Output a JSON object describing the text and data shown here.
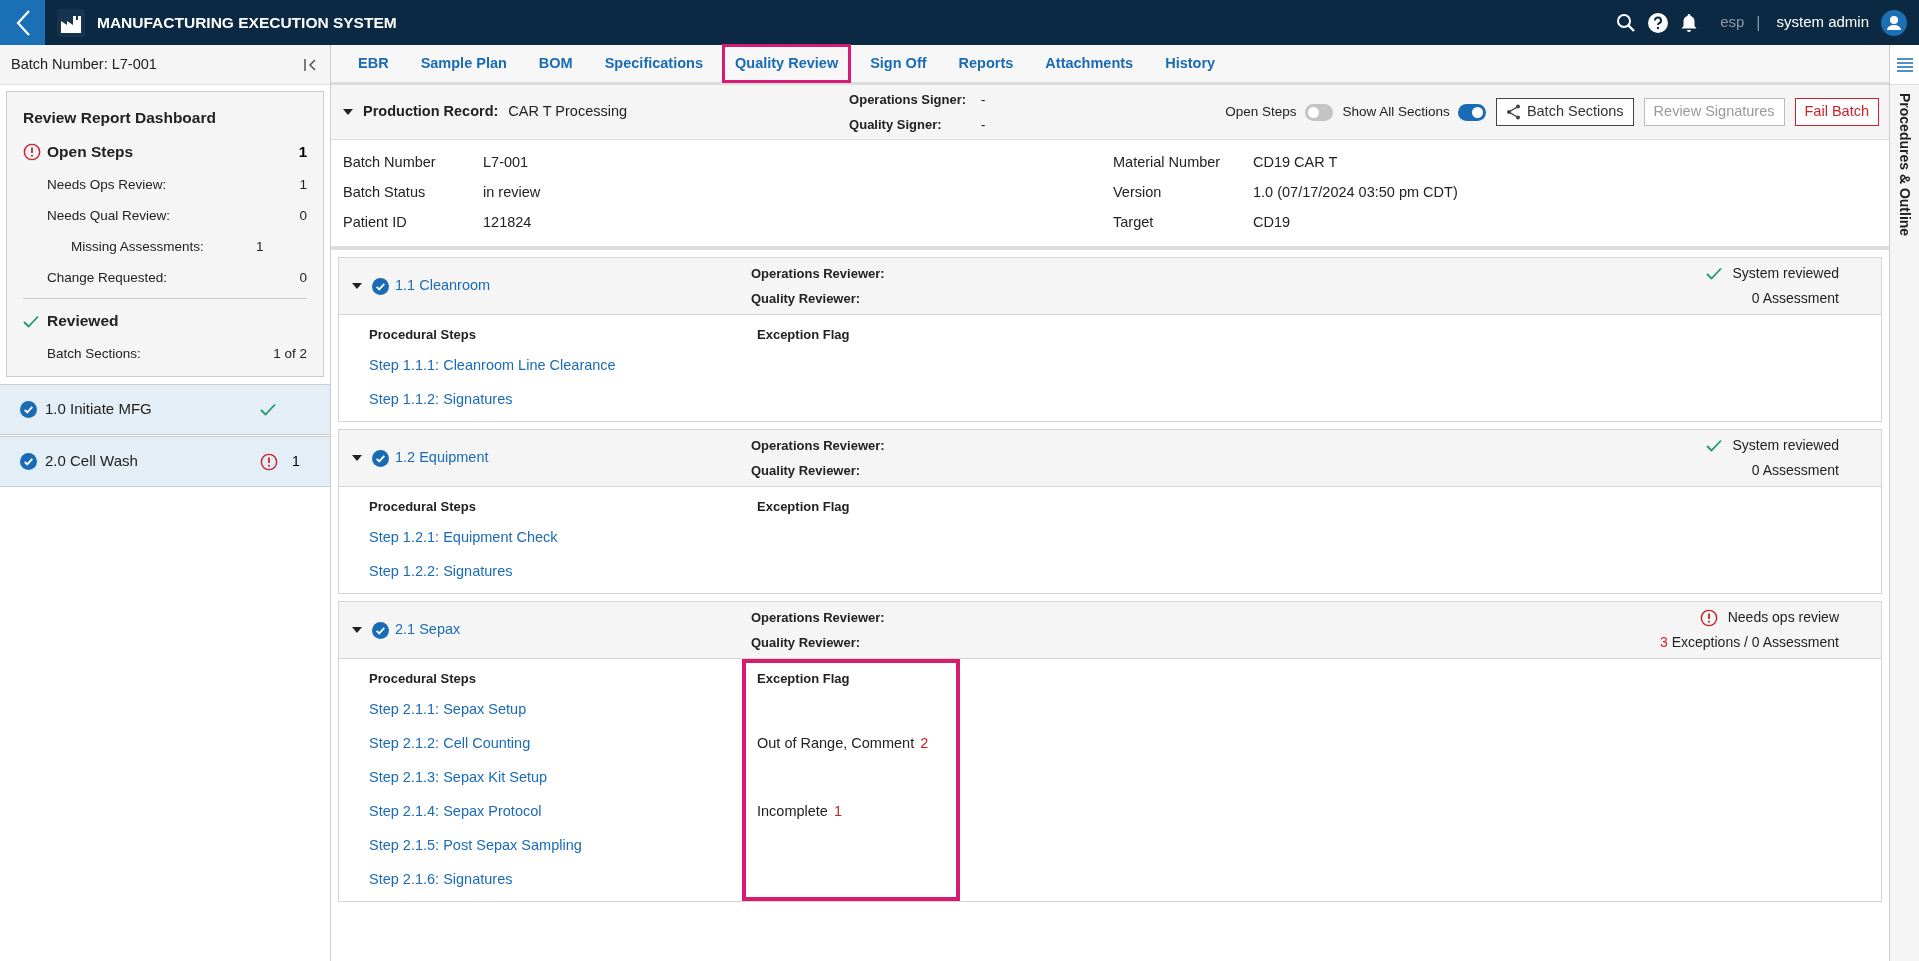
{
  "app": {
    "title": "MANUFACTURING EXECUTION SYSTEM",
    "user_group": "esp",
    "user": "system admin",
    "separator": "|"
  },
  "sidebar": {
    "title": "Batch Number: L7-001",
    "dashboard": {
      "title": "Review Report Dashboard",
      "groups": [
        {
          "kind": "alert",
          "label": "Open Steps",
          "count": "1",
          "rows": [
            {
              "label": "Needs Ops Review:",
              "value": "1"
            },
            {
              "label": "Needs Qual Review:",
              "value": "0",
              "children": [
                {
                  "label": "Missing Assessments:",
                  "value": "1"
                }
              ]
            },
            {
              "label": "Change Requested:",
              "value": "0"
            }
          ]
        },
        {
          "kind": "check",
          "label": "Reviewed",
          "rows": [
            {
              "label": "Batch Sections:",
              "value": "1 of 2"
            }
          ]
        }
      ]
    },
    "items": [
      {
        "label": "1.0 Initiate MFG",
        "kind": "check"
      },
      {
        "label": "2.0 Cell Wash",
        "kind": "alert",
        "count": "1"
      }
    ]
  },
  "tabs": [
    {
      "label": "EBR",
      "selected": false
    },
    {
      "label": "Sample Plan",
      "selected": false
    },
    {
      "label": "BOM",
      "selected": false
    },
    {
      "label": "Specifications",
      "selected": false
    },
    {
      "label": "Quality Review",
      "selected": true
    },
    {
      "label": "Sign Off",
      "selected": false
    },
    {
      "label": "Reports",
      "selected": false
    },
    {
      "label": "Attachments",
      "selected": false
    },
    {
      "label": "History",
      "selected": false
    }
  ],
  "production_record": {
    "label": "Production Record:",
    "value": "CAR T Processing",
    "signers": [
      {
        "label": "Operations Signer:",
        "value": "-"
      },
      {
        "label": "Quality Signer:",
        "value": "-"
      }
    ],
    "toggles": [
      {
        "label": "Open Steps",
        "on": false
      },
      {
        "label": "Show All Sections",
        "on": true
      }
    ],
    "buttons": [
      {
        "label": "Batch Sections",
        "kind": "share"
      },
      {
        "label": "Review Signatures",
        "kind": "disabled"
      },
      {
        "label": "Fail Batch",
        "kind": "danger"
      }
    ]
  },
  "details": {
    "left": [
      {
        "label": "Batch Number",
        "value": "L7-001"
      },
      {
        "label": "Batch Status",
        "value": "in review"
      },
      {
        "label": "Patient ID",
        "value": "121824"
      }
    ],
    "right": [
      {
        "label": "Material Number",
        "value": "CD19 CAR T"
      },
      {
        "label": "Version",
        "value": "1.0 (07/17/2024 03:50 pm CDT)"
      },
      {
        "label": "Target",
        "value": "CD19"
      }
    ]
  },
  "sections": [
    {
      "title": "1.1 Cleanroom",
      "reviewers": [
        "Operations Reviewer:",
        "Quality Reviewer:"
      ],
      "kind": "check",
      "status": "System reviewed",
      "assessment": "0 Assessment",
      "columns": [
        "Procedural Steps",
        "Exception Flag"
      ],
      "highlighted": false,
      "steps": [
        {
          "label": "Step 1.1.1: Cleanroom Line Clearance"
        },
        {
          "label": "Step 1.1.2: Signatures"
        }
      ]
    },
    {
      "title": "1.2 Equipment",
      "reviewers": [
        "Operations Reviewer:",
        "Quality Reviewer:"
      ],
      "kind": "check",
      "status": "System reviewed",
      "assessment": "0 Assessment",
      "columns": [
        "Procedural Steps",
        "Exception Flag"
      ],
      "highlighted": false,
      "steps": [
        {
          "label": "Step 1.2.1: Equipment Check"
        },
        {
          "label": "Step 1.2.2: Signatures"
        }
      ]
    },
    {
      "title": "2.1 Sepax",
      "reviewers": [
        "Operations Reviewer:",
        "Quality Reviewer:"
      ],
      "kind": "alert",
      "status": "Needs ops review",
      "exceptions": "3",
      "assessment": "Exceptions / 0 Assessment",
      "columns": [
        "Procedural Steps",
        "Exception Flag"
      ],
      "highlighted": true,
      "steps": [
        {
          "label": "Step 2.1.1: Sepax Setup"
        },
        {
          "label": "Step 2.1.2: Cell Counting",
          "flag": "Out of Range, Comment",
          "flag_count": "2"
        },
        {
          "label": "Step 2.1.3: Sepax Kit Setup"
        },
        {
          "label": "Step 2.1.4: Sepax Protocol",
          "flag": "Incomplete",
          "flag_count": "1"
        },
        {
          "label": "Step 2.1.5: Post Sepax Sampling"
        },
        {
          "label": "Step 2.1.6: Signatures"
        }
      ]
    }
  ],
  "side_panel": {
    "title": "Procedures & Outline"
  }
}
